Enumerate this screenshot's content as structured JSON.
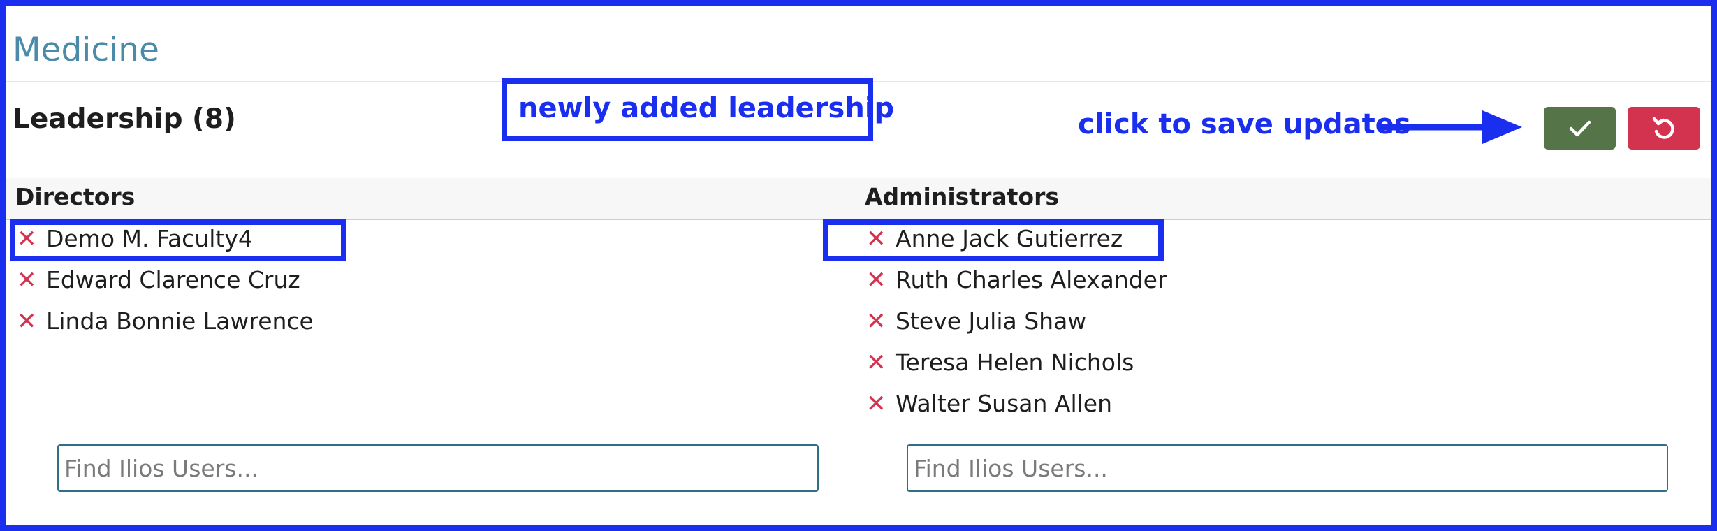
{
  "school": {
    "title": "Medicine"
  },
  "leadership": {
    "title": "Leadership (8)",
    "save_icon": "check-icon",
    "cancel_icon": "undo-icon"
  },
  "annotations": {
    "newly_added": "newly added leadership",
    "save_hint": "click to save updates"
  },
  "directors": {
    "header": "Directors",
    "items": [
      {
        "name": "Demo M. Faculty4"
      },
      {
        "name": "Edward Clarence Cruz"
      },
      {
        "name": "Linda Bonnie Lawrence"
      }
    ],
    "search_placeholder": "Find Ilios Users..."
  },
  "administrators": {
    "header": "Administrators",
    "items": [
      {
        "name": "Anne Jack Gutierrez"
      },
      {
        "name": "Ruth Charles Alexander"
      },
      {
        "name": "Steve Julia Shaw"
      },
      {
        "name": "Teresa Helen Nichols"
      },
      {
        "name": "Walter Susan Allen"
      }
    ],
    "search_placeholder": "Find Ilios Users..."
  },
  "colors": {
    "annotation": "#1a2ef0",
    "title": "#4b8aa8",
    "save": "#557549",
    "cancel": "#d43350"
  }
}
